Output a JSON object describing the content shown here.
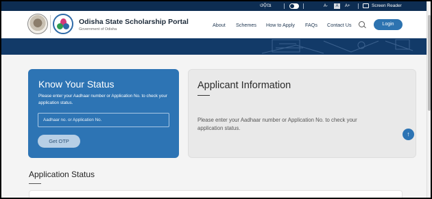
{
  "topbar": {
    "language_label": "ଓଡ଼ିଆ",
    "font_small": "A-",
    "font_normal": "A",
    "font_large": "A+",
    "screen_reader_label": "Screen Reader"
  },
  "header": {
    "title": "Odisha State Scholarship Portal",
    "subtitle": "Government of Odisha",
    "nav": [
      "About",
      "Schemes",
      "How to Apply",
      "FAQs",
      "Contact Us"
    ],
    "login_label": "Login"
  },
  "status_card": {
    "title": "Know Your Status",
    "description": "Please enter your Aadhaar number or Application No. to check your application status.",
    "input_placeholder": "Aadhaar no. or Application No.",
    "input_value": "",
    "otp_label": "Get OTP"
  },
  "info_card": {
    "title": "Applicant Information",
    "message": "Please enter your Aadhaar number or Application No. to check your application status."
  },
  "application_status": {
    "title": "Application Status"
  },
  "icons": {
    "scroll_top": "arrow-up-icon",
    "search": "search-icon",
    "screen_reader": "monitor-icon",
    "theme_toggle": "toggle-icon"
  },
  "colors": {
    "brand_dark": "#0d2d52",
    "accent_blue": "#2d74b4"
  }
}
